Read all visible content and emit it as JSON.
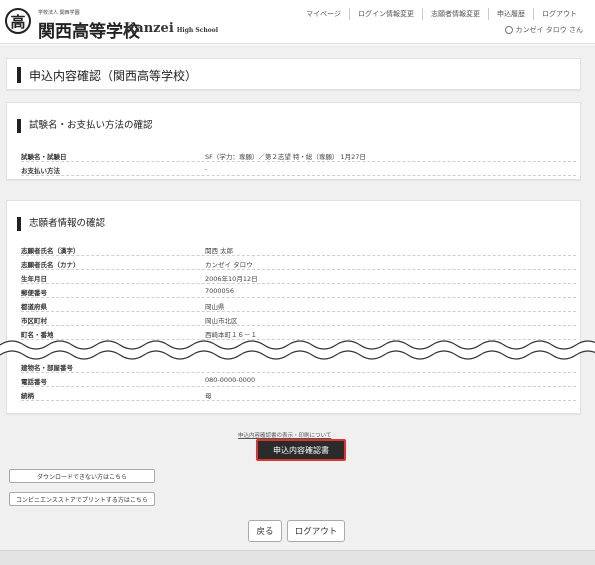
{
  "header": {
    "logo_char": "高",
    "school_sub": "学校法人 関西学園",
    "school_name": "関西高等学校",
    "school_en": "Kanzei",
    "school_en_sub": "High School",
    "nav": [
      "マイページ",
      "ログイン情報変更",
      "志願者情報変更",
      "申込履歴",
      "ログアウト"
    ],
    "user_name": "カンゼイ タロウ さん"
  },
  "page_title": "申込内容確認（関西高等学校）",
  "exam_section": {
    "heading": "試験名・お支払い方法の確認",
    "rows": [
      {
        "label": "試験名・試験日",
        "value": "SF（学力：専願）／第２志望 特・総（専願） 1月27日"
      },
      {
        "label": "お支払い方法",
        "value": "-"
      }
    ]
  },
  "applicant_section": {
    "heading": "志願者情報の確認",
    "rows": [
      {
        "label": "志願者氏名（漢字）",
        "value": "関西 太郎"
      },
      {
        "label": "志願者氏名（カナ）",
        "value": "カンゼイ タロウ"
      },
      {
        "label": "生年月日",
        "value": "2006年10月12日"
      },
      {
        "label": "郵便番号",
        "value": "7000056"
      },
      {
        "label": "都道府県",
        "value": "岡山県"
      },
      {
        "label": "市区町村",
        "value": "岡山市北区"
      },
      {
        "label": "町名・番地",
        "value": "西崎本町１６－１"
      }
    ],
    "rows_after_break": [
      {
        "label": "建物名・部屋番号",
        "value": ""
      },
      {
        "label": "電話番号",
        "value": "080-0000-0000"
      },
      {
        "label": "続柄",
        "value": "母"
      }
    ]
  },
  "actions": {
    "link_text": "申込内容確認書の表示・印刷について",
    "confirm_button": "申込内容確認書",
    "download_help": "ダウンロードできない方はこちら",
    "convenience_print": "コンビニエンスストアでプリントする方はこちら",
    "back_button": "戻る",
    "logout_button": "ログアウト"
  }
}
